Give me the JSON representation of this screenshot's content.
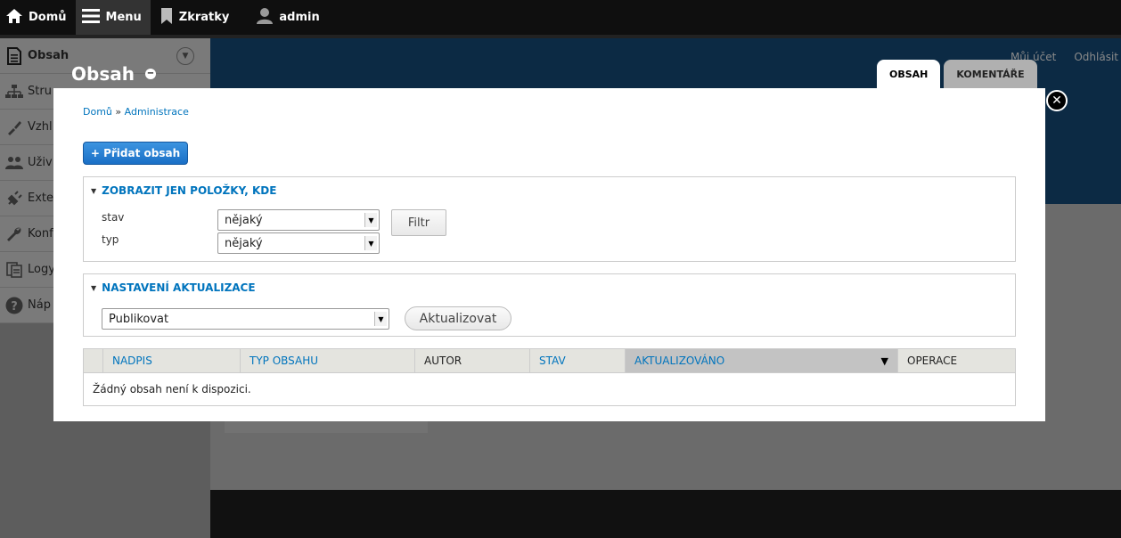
{
  "toolbar": {
    "home": "Domů",
    "menu": "Menu",
    "shortcuts": "Zkratky",
    "user": "admin"
  },
  "tray": {
    "items": [
      {
        "label": "Obsah",
        "icon": "document-icon"
      },
      {
        "label": "Stru",
        "icon": "sitemap-icon"
      },
      {
        "label": "Vzhl",
        "icon": "brush-icon"
      },
      {
        "label": "Uživ",
        "icon": "users-icon"
      },
      {
        "label": "Exte",
        "icon": "plug-icon"
      },
      {
        "label": "Konf",
        "icon": "wrench-icon"
      },
      {
        "label": "Logy",
        "icon": "reports-icon"
      },
      {
        "label": "Náp",
        "icon": "help-icon"
      }
    ]
  },
  "header": {
    "title": "Obsah",
    "my_account": "Můj účet",
    "logout": "Odhlásit"
  },
  "tabs": [
    {
      "label": "OBSAH",
      "active": true
    },
    {
      "label": "KOMENTÁŘE",
      "active": false
    }
  ],
  "breadcrumb": {
    "home": "Domů",
    "sep": " » ",
    "admin": "Administrace"
  },
  "add_content_label": "+ Přidat obsah",
  "filter": {
    "legend": "ZOBRAZIT JEN POLOŽKY, KDE",
    "status_label": "stav",
    "status_value": "nějaký",
    "type_label": "typ",
    "type_value": "nějaký",
    "button": "Filtr"
  },
  "update": {
    "legend": "NASTAVENÍ AKTUALIZACE",
    "action_value": "Publikovat",
    "button": "Aktualizovat"
  },
  "table": {
    "columns": [
      "NADPIS",
      "TYP OBSAHU",
      "AUTOR",
      "STAV",
      "AKTUALIZOVÁNO",
      "OPERACE"
    ],
    "empty": "Žádný obsah není k dispozici."
  },
  "colors": {
    "accent": "#0074bd",
    "primary_button": "#1a6fc6"
  }
}
